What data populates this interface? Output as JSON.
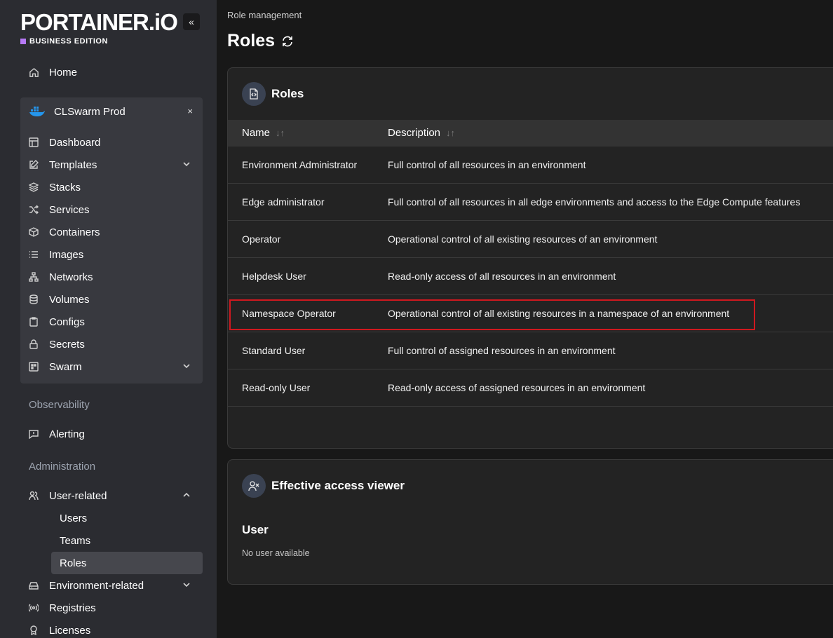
{
  "brand": {
    "logo_text": "PORTAINER.iO",
    "edition": "BUSINESS EDITION",
    "edition_color": "#b679f5",
    "collapse_icon": "«"
  },
  "sidebar": {
    "home": "Home",
    "environment": {
      "name": "CLSwarm Prod",
      "close": "×",
      "items": [
        {
          "label": "Dashboard",
          "icon": "dashboard-icon"
        },
        {
          "label": "Templates",
          "icon": "edit-icon",
          "chevron": "down"
        },
        {
          "label": "Stacks",
          "icon": "layers-icon"
        },
        {
          "label": "Services",
          "icon": "shuffle-icon"
        },
        {
          "label": "Containers",
          "icon": "box-icon"
        },
        {
          "label": "Images",
          "icon": "list-icon"
        },
        {
          "label": "Networks",
          "icon": "network-icon"
        },
        {
          "label": "Volumes",
          "icon": "database-icon"
        },
        {
          "label": "Configs",
          "icon": "clipboard-icon"
        },
        {
          "label": "Secrets",
          "icon": "lock-icon"
        },
        {
          "label": "Swarm",
          "icon": "swarm-icon",
          "chevron": "down"
        }
      ]
    },
    "observability_label": "Observability",
    "alerting": "Alerting",
    "administration_label": "Administration",
    "user_related": "User-related",
    "user_sub": [
      "Users",
      "Teams",
      "Roles"
    ],
    "environment_related": "Environment-related",
    "registries": "Registries",
    "licenses": "Licenses"
  },
  "main": {
    "breadcrumb": "Role management",
    "title": "Roles",
    "roles_card": {
      "title": "Roles",
      "columns": [
        "Name",
        "Description"
      ],
      "sort_icon": "↓↑",
      "rows": [
        {
          "name": "Environment Administrator",
          "description": "Full control of all resources in an environment"
        },
        {
          "name": "Edge administrator",
          "description": "Full control of all resources in all edge environments and access to the Edge Compute features"
        },
        {
          "name": "Operator",
          "description": "Operational control of all existing resources of an environment"
        },
        {
          "name": "Helpdesk User",
          "description": "Read-only access of all resources in an environment"
        },
        {
          "name": "Namespace Operator",
          "description": "Operational control of all existing resources in a namespace of an environment"
        },
        {
          "name": "Standard User",
          "description": "Full control of assigned resources in an environment"
        },
        {
          "name": "Read-only User",
          "description": "Read-only access of assigned resources in an environment"
        }
      ],
      "highlight_color": "#d0181f"
    },
    "access_card": {
      "title": "Effective access viewer",
      "user_label": "User",
      "empty_text": "No user available"
    }
  }
}
